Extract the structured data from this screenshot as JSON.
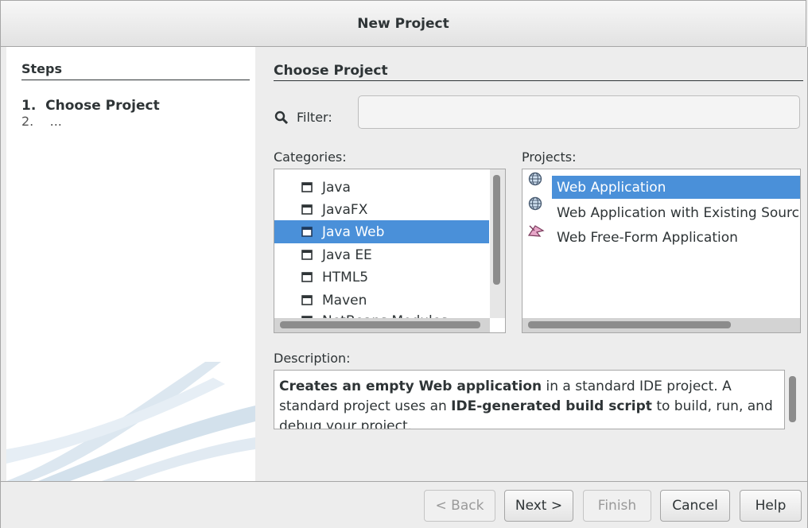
{
  "window": {
    "title": "New Project"
  },
  "steps": {
    "title": "Steps",
    "items": [
      {
        "num": "1.",
        "label": "Choose Project"
      },
      {
        "num": "2.",
        "label": "..."
      }
    ]
  },
  "main": {
    "title": "Choose Project",
    "filter_label": "Filter:",
    "filter_value": "",
    "categories_label": "Categories:",
    "categories": [
      "Java",
      "JavaFX",
      "Java Web",
      "Java EE",
      "HTML5",
      "Maven",
      "NetBeans Modules"
    ],
    "selected_category": "Java Web",
    "projects_label": "Projects:",
    "projects": [
      {
        "label": "Web Application",
        "icon": "globe-icon"
      },
      {
        "label": "Web Application with Existing Sources",
        "icon": "globe-icon"
      },
      {
        "label": "Web Free-Form Application",
        "icon": "freeform-icon"
      }
    ],
    "selected_project": "Web Application",
    "description_label": "Description:",
    "description": {
      "p1_bold": "Creates an empty Web application",
      "p1_rest": " in a standard IDE project. A standard project uses an ",
      "p2_bold": "IDE-generated build script",
      "p2_rest": " to build, run, and debug your project."
    }
  },
  "buttons": {
    "back": "< Back",
    "next": "Next >",
    "finish": "Finish",
    "cancel": "Cancel",
    "help": "Help"
  },
  "colors": {
    "selection": "#4a90d9",
    "accent_folder": "#2e3436"
  }
}
